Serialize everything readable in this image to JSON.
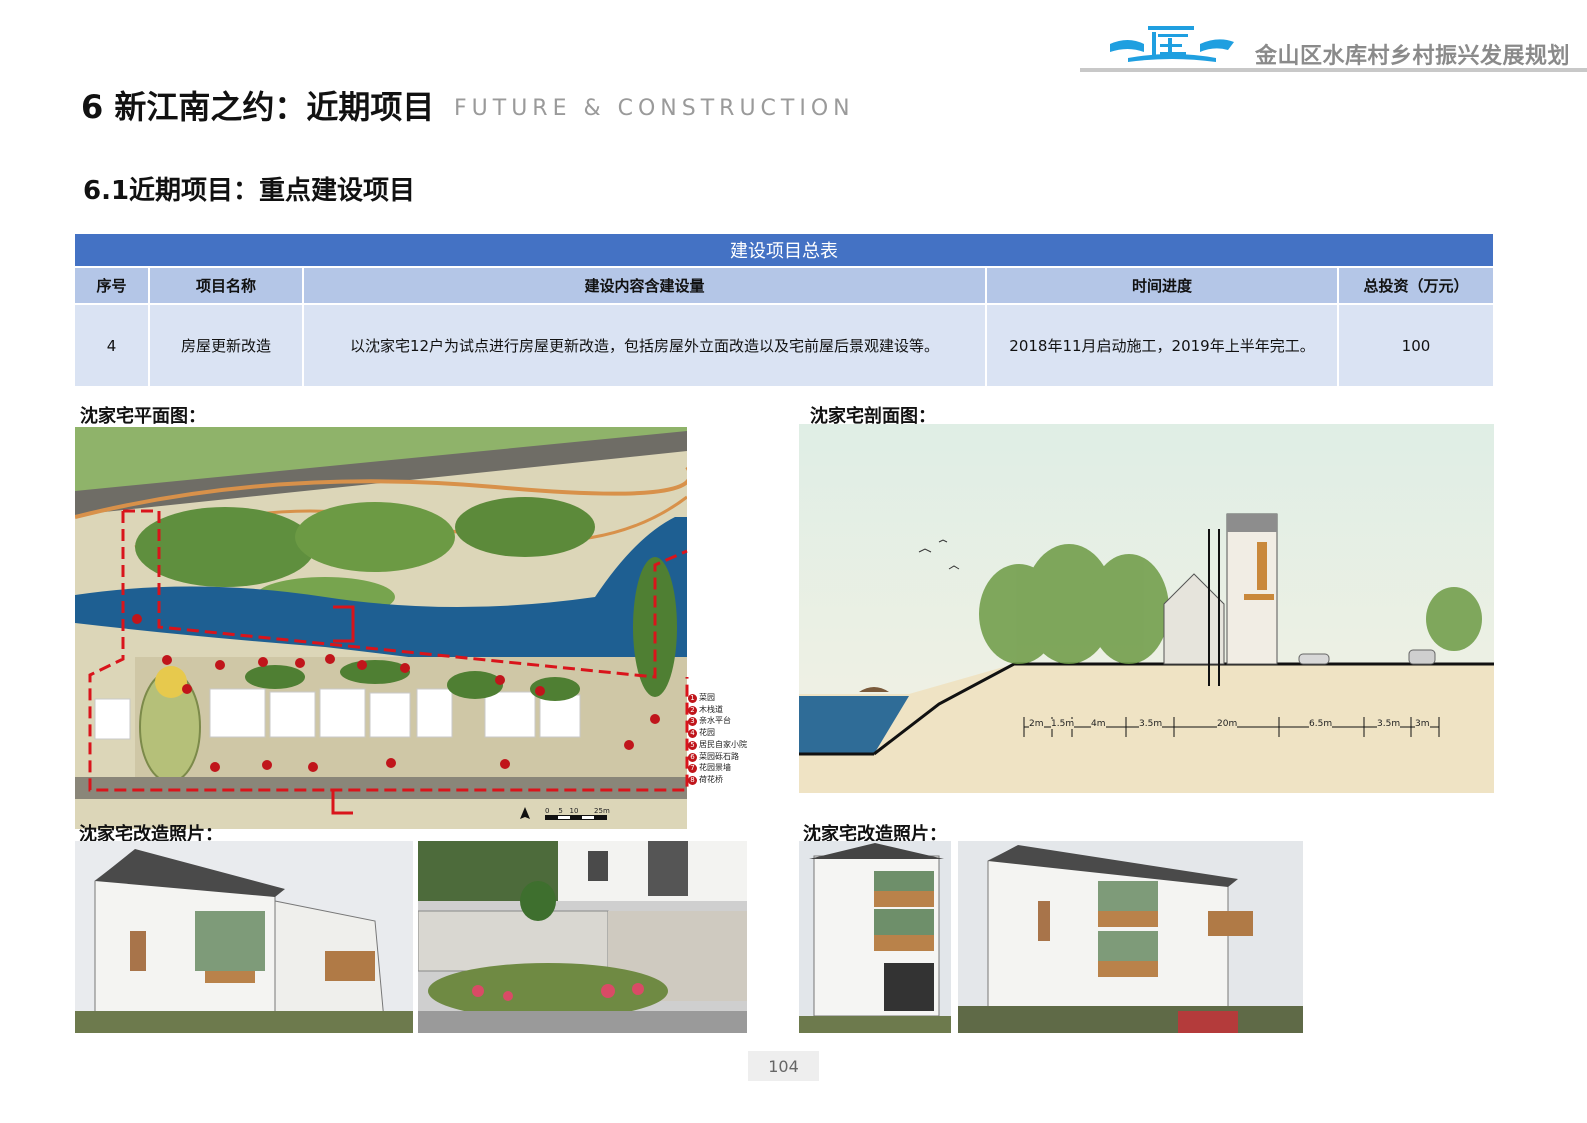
{
  "header": {
    "brand_title": "金山区水库村乡村振兴发展规划",
    "logo_icon": "water-village-logo"
  },
  "section": {
    "title": "6 新江南之约：近期项目",
    "subtitle": "FUTURE & CONSTRUCTION"
  },
  "subsection": {
    "title": "6.1近期项目：重点建设项目"
  },
  "table": {
    "title": "建设项目总表",
    "headers": [
      "序号",
      "项目名称",
      "建设内容含建设量",
      "时间进度",
      "总投资（万元）"
    ],
    "rows": [
      [
        "4",
        "房屋更新改造",
        "以沈家宅12户为试点进行房屋更新改造，包括房屋外立面改造以及宅前屋后景观建设等。",
        "2018年11月启动施工，2019年上半年完工。",
        "100"
      ]
    ]
  },
  "panels": {
    "plan_label": "沈家宅平面图：",
    "section_label": "沈家宅剖面图：",
    "photos_left_label": "沈家宅改造照片：",
    "photos_right_label": "沈家宅改造照片："
  },
  "plan_legend": [
    {
      "num": "1",
      "text": "菜园"
    },
    {
      "num": "2",
      "text": "木栈道"
    },
    {
      "num": "3",
      "text": "亲水平台"
    },
    {
      "num": "4",
      "text": "花园"
    },
    {
      "num": "5",
      "text": "居民自家小院"
    },
    {
      "num": "6",
      "text": "菜园砾石路"
    },
    {
      "num": "7",
      "text": "花园景墙"
    },
    {
      "num": "8",
      "text": "荷花桥"
    }
  ],
  "plan_scale": [
    "0",
    "5",
    "10",
    "25m"
  ],
  "section_dimensions": [
    "2m",
    "1.5m",
    "4m",
    "3.5m",
    "20m",
    "6.5m",
    "3.5m",
    "3m"
  ],
  "page": {
    "number": "104"
  },
  "colors": {
    "table_title_bg": "#4472c4",
    "table_header_bg": "#b4c6e7",
    "table_body_bg": "#dae3f3",
    "brand_blue": "#1f9fe0",
    "plan_boundary_red": "#d9141b",
    "water_blue": "#1e5f92"
  }
}
